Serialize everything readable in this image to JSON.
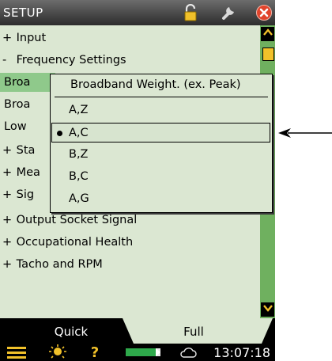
{
  "titlebar": {
    "title": "SETUP",
    "icons": [
      "lock-icon",
      "wrench-icon",
      "close-icon"
    ]
  },
  "menu": {
    "items": [
      {
        "prefix": "+",
        "label": "Input"
      },
      {
        "prefix": "-",
        "label": "Frequency Settings"
      },
      {
        "prefix": "",
        "label": "Broa"
      },
      {
        "prefix": "",
        "label": "Broa"
      },
      {
        "prefix": "",
        "label": "Low"
      },
      {
        "prefix": "+",
        "label": "Sta"
      },
      {
        "prefix": "+",
        "label": "Mea"
      },
      {
        "prefix": "+",
        "label": "Sig"
      },
      {
        "prefix": "+",
        "label": "Output Socket Signal"
      },
      {
        "prefix": "+",
        "label": "Occupational Health"
      },
      {
        "prefix": "+",
        "label": "Tacho and RPM"
      }
    ]
  },
  "popup": {
    "title": "Broadband Weight. (ex. Peak)",
    "options": [
      "A,Z",
      "A,C",
      "B,Z",
      "B,C",
      "A,G"
    ],
    "selected": "A,C"
  },
  "tabs": {
    "quick": "Quick",
    "full": "Full",
    "active": "Full"
  },
  "status": {
    "time": "13:07:18",
    "icons": [
      "menu-icon",
      "light-icon",
      "help-icon",
      "battery-icon",
      "cloud-icon"
    ]
  },
  "colors": {
    "list_bg": "#dbe7d2",
    "selection_green": "#8fc98b",
    "scrollbar_green": "#6fb05f",
    "accent_yellow": "#f1c12a",
    "close_red": "#e0442c"
  }
}
